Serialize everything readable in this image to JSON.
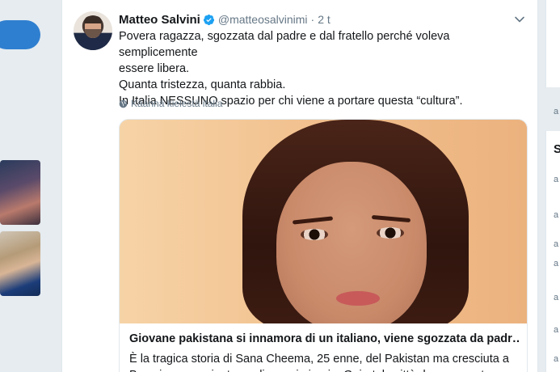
{
  "tweet": {
    "author_name": "Matteo Salvini",
    "handle": "@matteosalvinimi",
    "separator": "·",
    "time": "2 t",
    "lines": [
      "Povera ragazza, sgozzata dal padre e dal fratello perché voleva semplicemente",
      "essere libera.",
      "Quanta tristezza, quanta rabbia.",
      "In Italia NESSUNO spazio per chi viene a portare questa “cultura”."
    ],
    "translate_label": "Käännä kielestä italia",
    "card": {
      "title": "Giovane pakistana si innamora di un italiano, viene sgozzata da padr…",
      "description": "È la tragica storia di Sana Cheema, 25 enne, del Pakistan ma cresciuta a Brescia, assassinata negli scorsi giorni a Gujrat, la città dove era nata..."
    }
  },
  "right_column": {
    "glyph_1": "a",
    "heading_initial": "S",
    "glyphs": [
      "a",
      "a",
      "a",
      "a",
      "a",
      "a",
      "a"
    ]
  },
  "colors": {
    "accent": "#1da1f2",
    "tweet_button": "#2f7fd0",
    "muted_text": "#657786",
    "background": "#e6ecf0"
  },
  "icons": {
    "verified": "verified-badge-icon",
    "chevron": "chevron-down-icon",
    "globe": "globe-icon"
  }
}
